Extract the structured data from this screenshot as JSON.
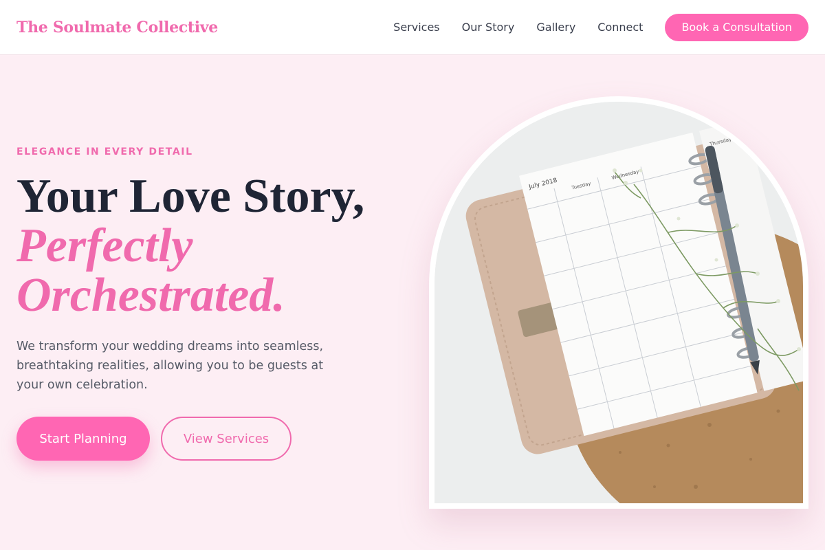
{
  "header": {
    "brand": "The Soulmate Collective",
    "nav": [
      "Services",
      "Our Story",
      "Gallery",
      "Connect"
    ],
    "cta": "Book a Consultation"
  },
  "hero": {
    "eyebrow": "ELEGANCE IN EVERY DETAIL",
    "headline_line1": "Your Love Story,",
    "headline_accent1": "Perfectly",
    "headline_accent2": "Orchestrated.",
    "description": "We transform your wedding dreams into seamless, breathtaking realities, allowing you to be guests at your own celebration.",
    "primary_button": "Start Planning",
    "secondary_button": "View Services"
  },
  "image": {
    "planner_date": "July 2018",
    "day_tuesday": "Tuesday",
    "day_wednesday": "Wednesday",
    "day_thursday": "Thursday"
  },
  "colors": {
    "accent": "#f06aad",
    "button": "#ff66b3",
    "background": "#fdeef4",
    "heading": "#1f2535"
  }
}
